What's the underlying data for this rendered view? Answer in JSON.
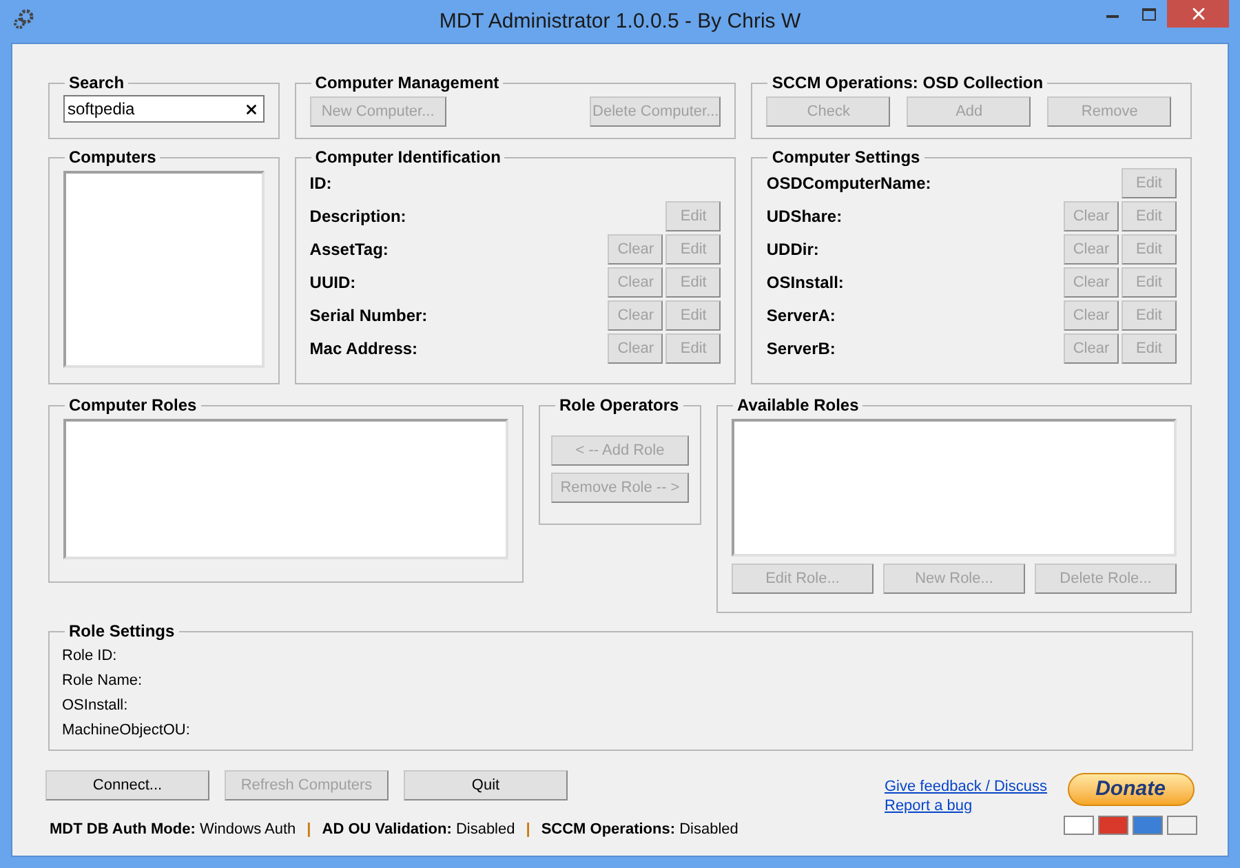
{
  "window": {
    "title": "MDT Administrator 1.0.0.5 - By Chris W"
  },
  "search": {
    "title": "Search",
    "value": "softpedia"
  },
  "computer_management": {
    "title": "Computer Management",
    "buttons": [
      {
        "label": "New Computer...",
        "disabled": true
      },
      {
        "label": "Delete Computer...",
        "disabled": true
      }
    ]
  },
  "sccm_operations": {
    "title": "SCCM Operations: OSD Collection",
    "buttons": [
      {
        "label": "Check",
        "disabled": true
      },
      {
        "label": "Add",
        "disabled": true
      },
      {
        "label": "Remove",
        "disabled": true
      }
    ]
  },
  "computers": {
    "title": "Computers"
  },
  "computer_identification": {
    "title": "Computer Identification",
    "rows": [
      {
        "label": "ID:",
        "buttons": []
      },
      {
        "label": "Description:",
        "buttons": [
          {
            "label": "Edit",
            "disabled": true
          }
        ]
      },
      {
        "label": "AssetTag:",
        "buttons": [
          {
            "label": "Clear",
            "disabled": true
          },
          {
            "label": "Edit",
            "disabled": true
          }
        ]
      },
      {
        "label": "UUID:",
        "buttons": [
          {
            "label": "Clear",
            "disabled": true
          },
          {
            "label": "Edit",
            "disabled": true
          }
        ]
      },
      {
        "label": "Serial Number:",
        "buttons": [
          {
            "label": "Clear",
            "disabled": true
          },
          {
            "label": "Edit",
            "disabled": true
          }
        ]
      },
      {
        "label": "Mac Address:",
        "buttons": [
          {
            "label": "Clear",
            "disabled": true
          },
          {
            "label": "Edit",
            "disabled": true
          }
        ]
      }
    ]
  },
  "computer_settings": {
    "title": "Computer Settings",
    "rows": [
      {
        "label": "OSDComputerName:",
        "buttons": [
          {
            "label": "Edit",
            "disabled": true
          }
        ]
      },
      {
        "label": "UDShare:",
        "buttons": [
          {
            "label": "Clear",
            "disabled": true
          },
          {
            "label": "Edit",
            "disabled": true
          }
        ]
      },
      {
        "label": "UDDir:",
        "buttons": [
          {
            "label": "Clear",
            "disabled": true
          },
          {
            "label": "Edit",
            "disabled": true
          }
        ]
      },
      {
        "label": "OSInstall:",
        "buttons": [
          {
            "label": "Clear",
            "disabled": true
          },
          {
            "label": "Edit",
            "disabled": true
          }
        ]
      },
      {
        "label": "ServerA:",
        "buttons": [
          {
            "label": "Clear",
            "disabled": true
          },
          {
            "label": "Edit",
            "disabled": true
          }
        ]
      },
      {
        "label": "ServerB:",
        "buttons": [
          {
            "label": "Clear",
            "disabled": true
          },
          {
            "label": "Edit",
            "disabled": true
          }
        ]
      }
    ]
  },
  "computer_roles": {
    "title": "Computer Roles"
  },
  "role_operators": {
    "title": "Role Operators",
    "buttons": [
      {
        "label": "< -- Add Role",
        "disabled": true
      },
      {
        "label": "Remove Role -- >",
        "disabled": true
      }
    ]
  },
  "available_roles": {
    "title": "Available Roles",
    "buttons": [
      {
        "label": "Edit Role...",
        "disabled": true
      },
      {
        "label": "New Role...",
        "disabled": true
      },
      {
        "label": "Delete Role...",
        "disabled": true
      }
    ]
  },
  "role_settings": {
    "title": "Role Settings",
    "fields": [
      "Role ID:",
      "Role Name:",
      "OSInstall:",
      "MachineObjectOU:"
    ]
  },
  "actions": [
    {
      "label": "Connect...",
      "disabled": false
    },
    {
      "label": "Refresh Computers",
      "disabled": true
    },
    {
      "label": "Quit",
      "disabled": false
    }
  ],
  "links": [
    "Give feedback / Discuss",
    "Report a bug"
  ],
  "donate": {
    "label": "Donate"
  },
  "status_bar": [
    {
      "kind": "field",
      "label": "MDT DB Auth Mode:",
      "value": "Windows Auth"
    },
    {
      "kind": "separator",
      "text": "|"
    },
    {
      "kind": "field",
      "label": "AD OU Validation:",
      "value": "Disabled"
    },
    {
      "kind": "separator",
      "text": "|"
    },
    {
      "kind": "field",
      "label": "SCCM Operations:",
      "value": "Disabled"
    }
  ]
}
